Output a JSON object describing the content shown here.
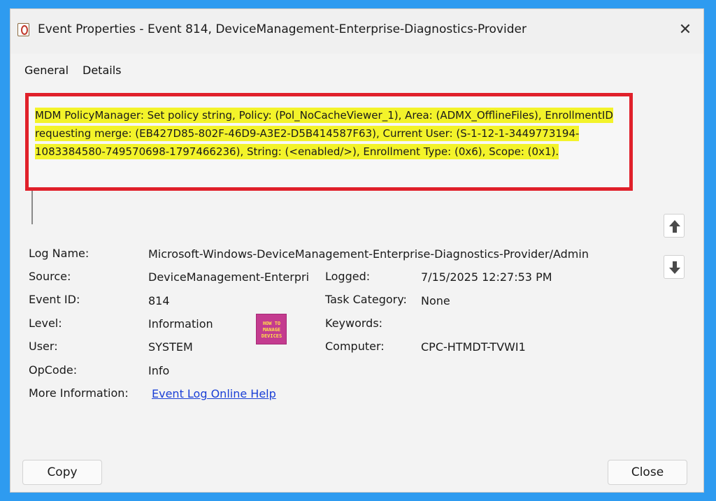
{
  "window": {
    "title": "Event Properties - Event 814, DeviceManagement-Enterprise-Diagnostics-Provider",
    "close_glyph": "✕"
  },
  "tabs": [
    {
      "label": "General"
    },
    {
      "label": "Details"
    }
  ],
  "description": {
    "text": "MDM PolicyManager: Set policy string, Policy: (Pol_NoCacheViewer_1), Area: (ADMX_OfflineFiles), EnrollmentID requesting merge: (EB427D85-802F-46D9-A3E2-D5B414587F63), Current User: (S-1-12-1-3449773194-1083384580-749570698-1797466236), String: (<enabled/>), Enrollment Type: (0x6), Scope: (0x1).",
    "highlight_color": "#f3f32a",
    "box_color": "#e0202a"
  },
  "fields": {
    "log_name": {
      "label": "Log Name:",
      "value": "Microsoft-Windows-DeviceManagement-Enterprise-Diagnostics-Provider/Admin"
    },
    "source": {
      "label": "Source:",
      "value": "DeviceManagement-Enterpri"
    },
    "logged": {
      "label": "Logged:",
      "value": "7/15/2025 12:27:53 PM"
    },
    "event_id": {
      "label": "Event ID:",
      "value": "814"
    },
    "task_category": {
      "label": "Task Category:",
      "value": "None"
    },
    "level": {
      "label": "Level:",
      "value": "Information"
    },
    "keywords": {
      "label": "Keywords:",
      "value": ""
    },
    "user": {
      "label": "User:",
      "value": "SYSTEM"
    },
    "computer": {
      "label": "Computer:",
      "value": "CPC-HTMDT-TVWI1"
    },
    "opcode": {
      "label": "OpCode:",
      "value": "Info"
    },
    "more_info": {
      "label": "More Information:",
      "value": "Event Log Online Help"
    }
  },
  "logo": {
    "line1": "HOW TO",
    "line2": "MANAGE",
    "line3": "DEVICES"
  },
  "buttons": {
    "copy": "Copy",
    "close": "Close"
  },
  "icons": {
    "scroll_up": "arrow-up-icon",
    "scroll_down": "arrow-down-icon"
  }
}
